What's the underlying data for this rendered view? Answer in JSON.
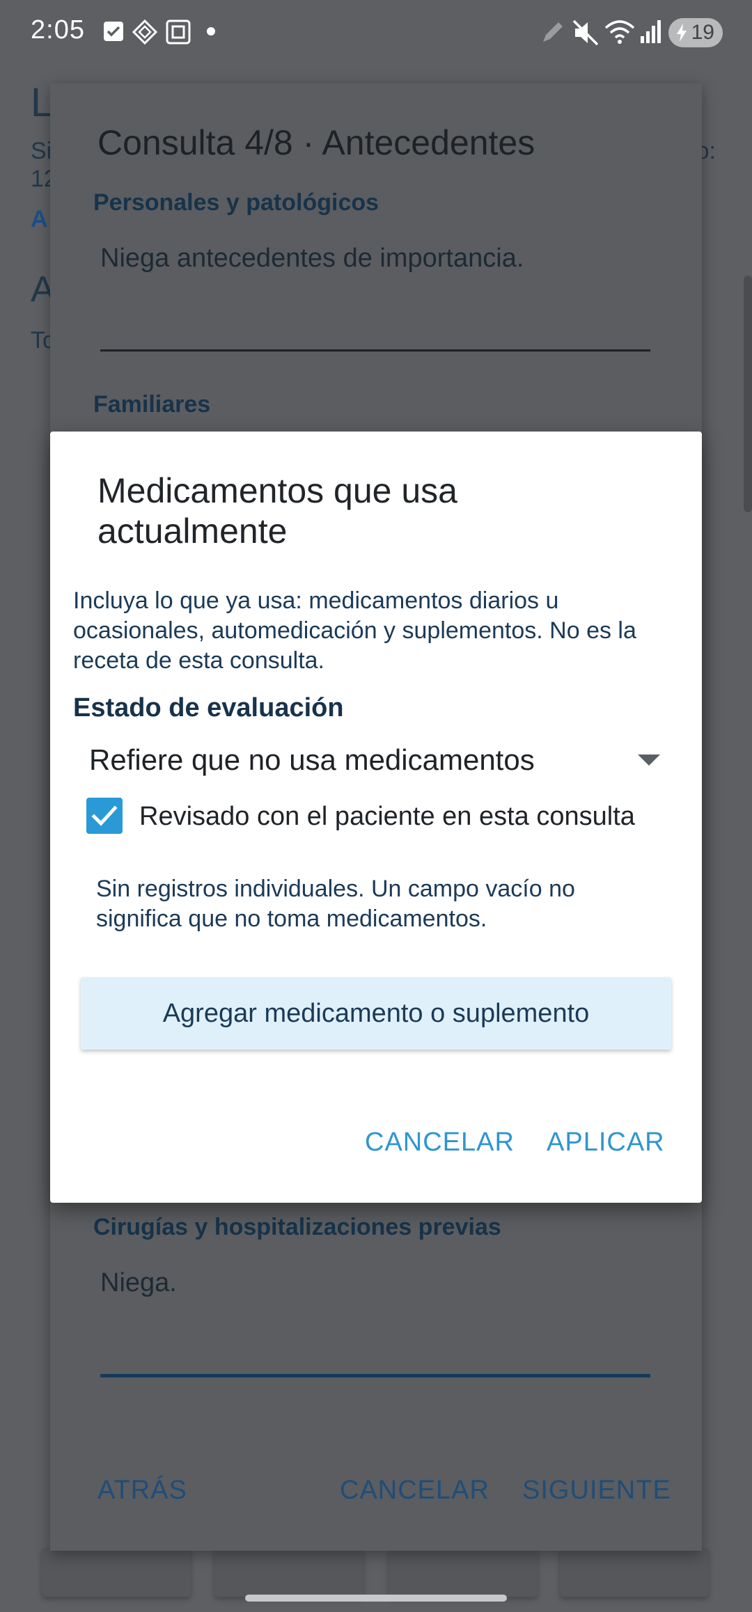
{
  "status_bar": {
    "time": "2:05",
    "battery": "19",
    "icons": [
      "checkbox-notification-icon",
      "diamond-app-icon",
      "square-app-icon",
      "dot-icon",
      "pen-icon",
      "mute-icon",
      "wifi-icon",
      "signal-icon",
      "battery-charging-icon"
    ]
  },
  "background_page": {
    "title_fragment": "L",
    "line1": "Si",
    "line2": "12",
    "link": "A",
    "heading_fragment": "A",
    "subtext_fragment": "To",
    "right_fragment": "o:"
  },
  "consult_dialog": {
    "title": "Consulta 4/8 · Antecedentes",
    "sections": [
      {
        "label": "Personales y patológicos",
        "value": "Niega antecedentes de importancia."
      },
      {
        "label": "Familiares",
        "value": ""
      },
      {
        "label": "Cirugías y hospitalizaciones previas",
        "value": "Niega."
      }
    ],
    "back_label": "ATRÁS",
    "cancel_label": "CANCELAR",
    "next_label": "SIGUIENTE"
  },
  "med_dialog": {
    "title": "Medicamentos que usa actualmente",
    "description": "Incluya lo que ya usa: medicamentos diarios u ocasionales, automedicación y suplementos. No es la receta de esta consulta.",
    "section_label": "Estado de evaluación",
    "status_value": "Refiere que no usa medicamentos",
    "reviewed_checked": true,
    "reviewed_label": "Revisado con el paciente en esta consulta",
    "empty_note": "Sin registros individuales. Un campo vacío no significa que no toma medicamentos.",
    "add_button": "Agregar medicamento o suplemento",
    "cancel_label": "CANCELAR",
    "apply_label": "APLICAR"
  },
  "colors": {
    "accent": "#2e95d3",
    "checkbox": "#2a9ad7",
    "add_button_bg": "#e0f0fb",
    "scrim": "#5d5f62"
  }
}
